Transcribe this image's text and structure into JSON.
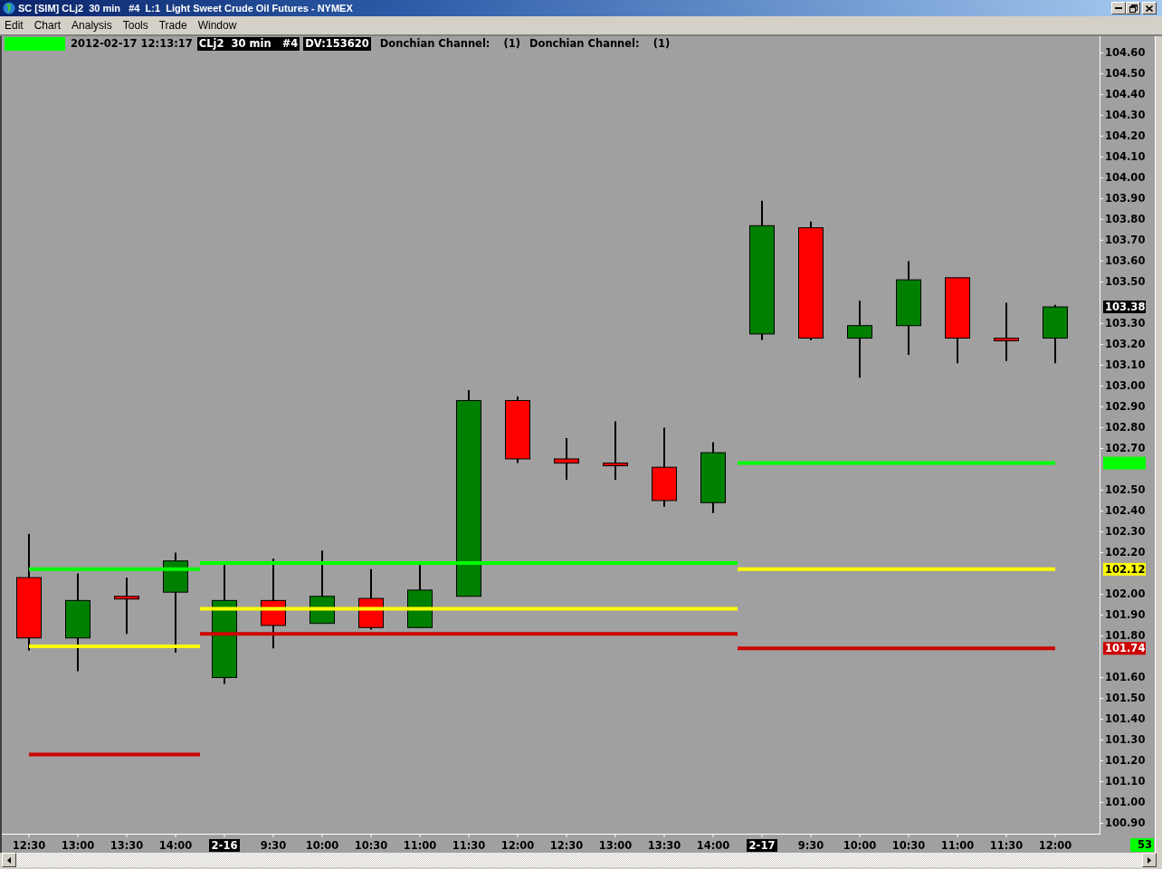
{
  "window": {
    "title": "SC [SIM] CLj2  30 min   #4  L:1  Light Sweet Crude Oil Futures - NYMEX"
  },
  "menu": [
    "Edit",
    "Chart",
    "Analysis",
    "Tools",
    "Trade",
    "Window"
  ],
  "info_bar": {
    "timestamp": "2012-02-17 12:13:17",
    "symbol": "CLj2  30 min   #4",
    "daily_volume": "DV:153620",
    "studies": [
      {
        "name": "Donchian Channel:",
        "input": "(1)"
      },
      {
        "name": "Donchian Channel:",
        "input": "(1)"
      }
    ]
  },
  "chart": {
    "chart_data": [
      {
        "type": "candlestick",
        "categories": [
          "12:30",
          "13:00",
          "13:30",
          "14:00",
          "2-16",
          "9:30",
          "10:00",
          "10:30",
          "11:00",
          "11:30",
          "12:00",
          "12:30",
          "13:00",
          "13:30",
          "14:00",
          "2-17",
          "9:30",
          "10:00",
          "10:30",
          "11:00",
          "11:30",
          "12:00"
        ],
        "ohlc": [
          [
            102.08,
            102.29,
            101.73,
            101.79
          ],
          [
            101.79,
            102.1,
            101.63,
            101.97
          ],
          [
            101.99,
            102.08,
            101.81,
            101.98
          ],
          [
            102.01,
            102.2,
            101.72,
            102.16
          ],
          [
            101.6,
            102.14,
            101.57,
            101.97
          ],
          [
            101.97,
            102.17,
            101.74,
            101.85
          ],
          [
            101.86,
            102.21,
            101.86,
            101.99
          ],
          [
            101.98,
            102.12,
            101.83,
            101.84
          ],
          [
            101.84,
            102.14,
            101.84,
            102.02
          ],
          [
            101.99,
            102.98,
            101.99,
            102.93
          ],
          [
            102.93,
            102.95,
            102.63,
            102.65
          ],
          [
            102.65,
            102.75,
            102.55,
            102.63
          ],
          [
            102.63,
            102.83,
            102.55,
            102.62
          ],
          [
            102.61,
            102.8,
            102.42,
            102.45
          ],
          [
            102.44,
            102.73,
            102.39,
            102.68
          ],
          [
            103.25,
            103.89,
            103.22,
            103.77
          ],
          [
            103.76,
            103.79,
            103.22,
            103.23
          ],
          [
            103.23,
            103.41,
            103.04,
            103.29
          ],
          [
            103.29,
            103.6,
            103.15,
            103.51
          ],
          [
            103.52,
            103.52,
            103.11,
            103.23
          ],
          [
            103.23,
            103.4,
            103.12,
            103.22
          ],
          [
            103.23,
            103.39,
            103.11,
            103.38
          ]
        ],
        "series": [
          {
            "type": "step",
            "color": "#00ff00",
            "values": [
              102.12,
              102.12,
              102.12,
              102.12,
              102.15,
              102.15,
              102.15,
              102.15,
              102.15,
              102.15,
              102.15,
              102.15,
              102.15,
              102.15,
              102.15,
              102.63,
              102.63,
              102.63,
              102.63,
              102.63,
              102.63,
              102.63
            ]
          },
          {
            "type": "step",
            "color": "#ffff00",
            "values": [
              101.75,
              101.75,
              101.75,
              101.75,
              101.93,
              101.93,
              101.93,
              101.93,
              101.93,
              101.93,
              101.93,
              101.93,
              101.93,
              101.93,
              101.93,
              102.12,
              102.12,
              102.12,
              102.12,
              102.12,
              102.12,
              102.12
            ]
          },
          {
            "type": "step",
            "color": "#cc0000",
            "values": [
              101.23,
              101.23,
              101.23,
              101.23,
              101.81,
              101.81,
              101.81,
              101.81,
              101.81,
              101.81,
              101.81,
              101.81,
              101.81,
              101.81,
              101.81,
              101.74,
              101.74,
              101.74,
              101.74,
              101.74,
              101.74,
              101.74
            ]
          }
        ],
        "ylim": [
          100.85,
          104.68
        ],
        "yticks": [
          {
            "value": 100.9,
            "label": "100.90"
          },
          {
            "value": 101,
            "label": "101.00"
          },
          {
            "value": 101.1,
            "label": "101.10"
          },
          {
            "value": 101.2,
            "label": "101.20"
          },
          {
            "value": 101.3,
            "label": "101.30"
          },
          {
            "value": 101.4,
            "label": "101.40"
          },
          {
            "value": 101.5,
            "label": "101.50"
          },
          {
            "value": 101.6,
            "label": "101.60"
          },
          {
            "value": 101.8,
            "label": "101.80"
          },
          {
            "value": 101.9,
            "label": "101.90"
          },
          {
            "value": 102,
            "label": "102.00"
          },
          {
            "value": 102.2,
            "label": "102.20"
          },
          {
            "value": 102.3,
            "label": "102.30"
          },
          {
            "value": 102.4,
            "label": "102.40"
          },
          {
            "value": 102.5,
            "label": "102.50"
          },
          {
            "value": 102.7,
            "label": "102.70"
          },
          {
            "value": 102.8,
            "label": "102.80"
          },
          {
            "value": 102.9,
            "label": "102.90"
          },
          {
            "value": 103,
            "label": "103.00"
          },
          {
            "value": 103.1,
            "label": "103.10"
          },
          {
            "value": 103.2,
            "label": "103.20"
          },
          {
            "value": 103.3,
            "label": "103.30"
          },
          {
            "value": 103.5,
            "label": "103.50"
          },
          {
            "value": 103.6,
            "label": "103.60"
          },
          {
            "value": 103.7,
            "label": "103.70"
          },
          {
            "value": 103.8,
            "label": "103.80"
          },
          {
            "value": 103.9,
            "label": "103.90"
          },
          {
            "value": 104,
            "label": "104.00"
          },
          {
            "value": 104.1,
            "label": "104.10"
          },
          {
            "value": 104.2,
            "label": "104.20"
          },
          {
            "value": 104.3,
            "label": "104.30"
          },
          {
            "value": 104.4,
            "label": "104.40"
          },
          {
            "value": 104.5,
            "label": "104.50"
          },
          {
            "value": 104.6,
            "label": "104.60"
          }
        ]
      }
    ],
    "price_markers": [
      {
        "kind": "last_price",
        "label": "103.38",
        "color": "#000000"
      },
      {
        "kind": "channel_end",
        "color": "#00ff00"
      },
      {
        "kind": "channel_end",
        "label": "102.12",
        "color": "#ffff00"
      },
      {
        "kind": "channel_end",
        "label": "101.74",
        "color": "#cc0000"
      }
    ]
  },
  "bar_count": "53"
}
